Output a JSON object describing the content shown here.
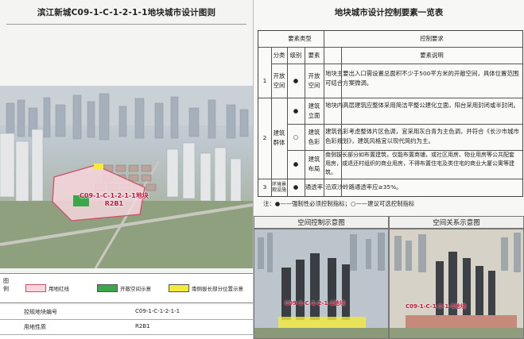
{
  "left": {
    "title": "滨江新城C09-1-C-1-2-1-1地块城市设计图则",
    "site_label_line1": "C09-1-C-1-2-1-1地块",
    "site_label_line2": "R2B1",
    "legend": {
      "head": "图例",
      "items": [
        {
          "label": "用地红线",
          "color": "#f6d6dc"
        },
        {
          "label": "开敞空间示意",
          "color": "#3aa84a"
        },
        {
          "label": "南侧拔长部分位置示意",
          "color": "#f3ea3a"
        }
      ]
    },
    "info": [
      {
        "label": "控规地块编号",
        "value": "C09-1-C-1-2-1-1"
      },
      {
        "label": "用地性质",
        "value": "R2B1"
      }
    ]
  },
  "right": {
    "title": "地块城市设计控制要素一览表",
    "table": {
      "col_group_head": "要素类型",
      "control_head": "控制要求",
      "sub_heads": [
        "分类",
        "级别",
        "要素",
        "要素说明"
      ],
      "rows": [
        {
          "num": "1",
          "category": "开放空间",
          "level": "●",
          "element": "开放空间",
          "desc": "地块主要出入口需设置总面积不少于500平方米的开敞空间，具体位置范围可结合方案微调。"
        },
        {
          "num": "2",
          "category": "建筑群体",
          "level": "●",
          "element": "建筑立面",
          "desc": "地块内高层建筑应整体采用简洁平整公建化立面，阳台采用封闭或半封闭。"
        },
        {
          "num": "",
          "category": "",
          "level": "○",
          "element": "建筑色彩",
          "desc": "建筑色彩考虑整体片区色调，宜采用灰白青为主色调，并符合《长沙市城市色彩规划》，建筑风格宜以现代简约为主。"
        },
        {
          "num": "",
          "category": "",
          "level": "●",
          "element": "建筑布局",
          "desc": "南侧拔长部分如布置建筑，仅能布置商铺，或社区用房、物业用房等公共配套用房，或退还村组织的商业用房，不得布置住宅及类住宅的商业大厦公寓等建筑。"
        },
        {
          "num": "3",
          "category": "环境景观设施",
          "level": "●",
          "element": "通透率",
          "desc": "沿双沙岭路通透率应≥35%。"
        }
      ]
    },
    "note": "注：●——强制性必须控制指标；○——建议可选控制指标",
    "panels": [
      {
        "title": "空间控制示意图",
        "site_label": "C09-1-C-1-2-1-1地块"
      },
      {
        "title": "空间关系示意图",
        "site_label": "C09-1-C-1-2-1-1地块"
      }
    ]
  }
}
